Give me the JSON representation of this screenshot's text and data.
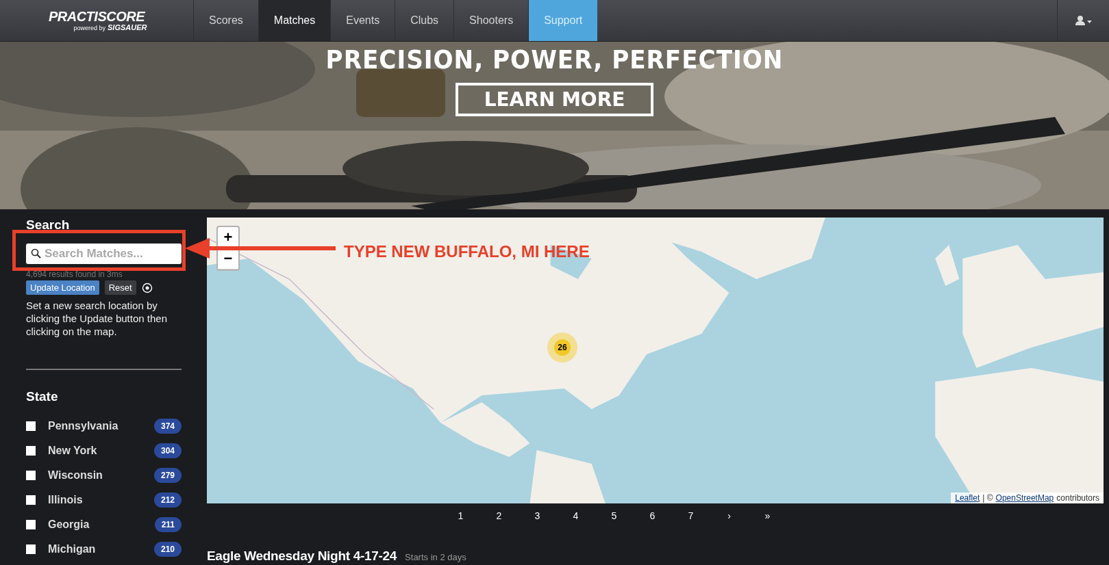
{
  "nav": {
    "logo": {
      "title": "PRACTISCORE",
      "subtitle": "powered by",
      "brand": "SIGSAUER"
    },
    "tabs": [
      {
        "label": "Scores",
        "selected": false,
        "highlighted": false
      },
      {
        "label": "Matches",
        "selected": true,
        "highlighted": false
      },
      {
        "label": "Events",
        "selected": false,
        "highlighted": false
      },
      {
        "label": "Clubs",
        "selected": false,
        "highlighted": false
      },
      {
        "label": "Shooters",
        "selected": false,
        "highlighted": false
      },
      {
        "label": "Support",
        "selected": false,
        "highlighted": true
      }
    ]
  },
  "banner": {
    "headline": "PRECISION, POWER, PERFECTION",
    "button": "LEARN MORE"
  },
  "sidebar": {
    "search": {
      "title": "Search",
      "placeholder": "Search Matches...",
      "results": "4,694 results found in 3ms",
      "update_button": "Update Location",
      "reset_button": "Reset",
      "help": "Set a new search location by clicking the Update button then clicking on the map."
    },
    "state": {
      "title": "State",
      "items": [
        {
          "name": "Pennsylvania",
          "count": "374",
          "checked": false
        },
        {
          "name": "New York",
          "count": "304",
          "checked": false
        },
        {
          "name": "Wisconsin",
          "count": "279",
          "checked": false
        },
        {
          "name": "Illinois",
          "count": "212",
          "checked": false
        },
        {
          "name": "Georgia",
          "count": "211",
          "checked": false
        },
        {
          "name": "Michigan",
          "count": "210",
          "checked": false
        }
      ]
    }
  },
  "map": {
    "zoom_in": "+",
    "zoom_out": "−",
    "cluster": "26",
    "attribution": {
      "leaflet": "Leaflet",
      "separator": "| ©",
      "osm": "OpenStreetMap",
      "rest": "contributors"
    }
  },
  "pagination": {
    "pages": [
      "1",
      "2",
      "3",
      "4",
      "5",
      "6",
      "7"
    ],
    "next": "›",
    "last": "»"
  },
  "match": {
    "title": "Eagle Wednesday Night 4-17-24",
    "when": "Starts in 2 days"
  },
  "annotation": {
    "text": "TYPE NEW BUFFALO, MI HERE"
  }
}
